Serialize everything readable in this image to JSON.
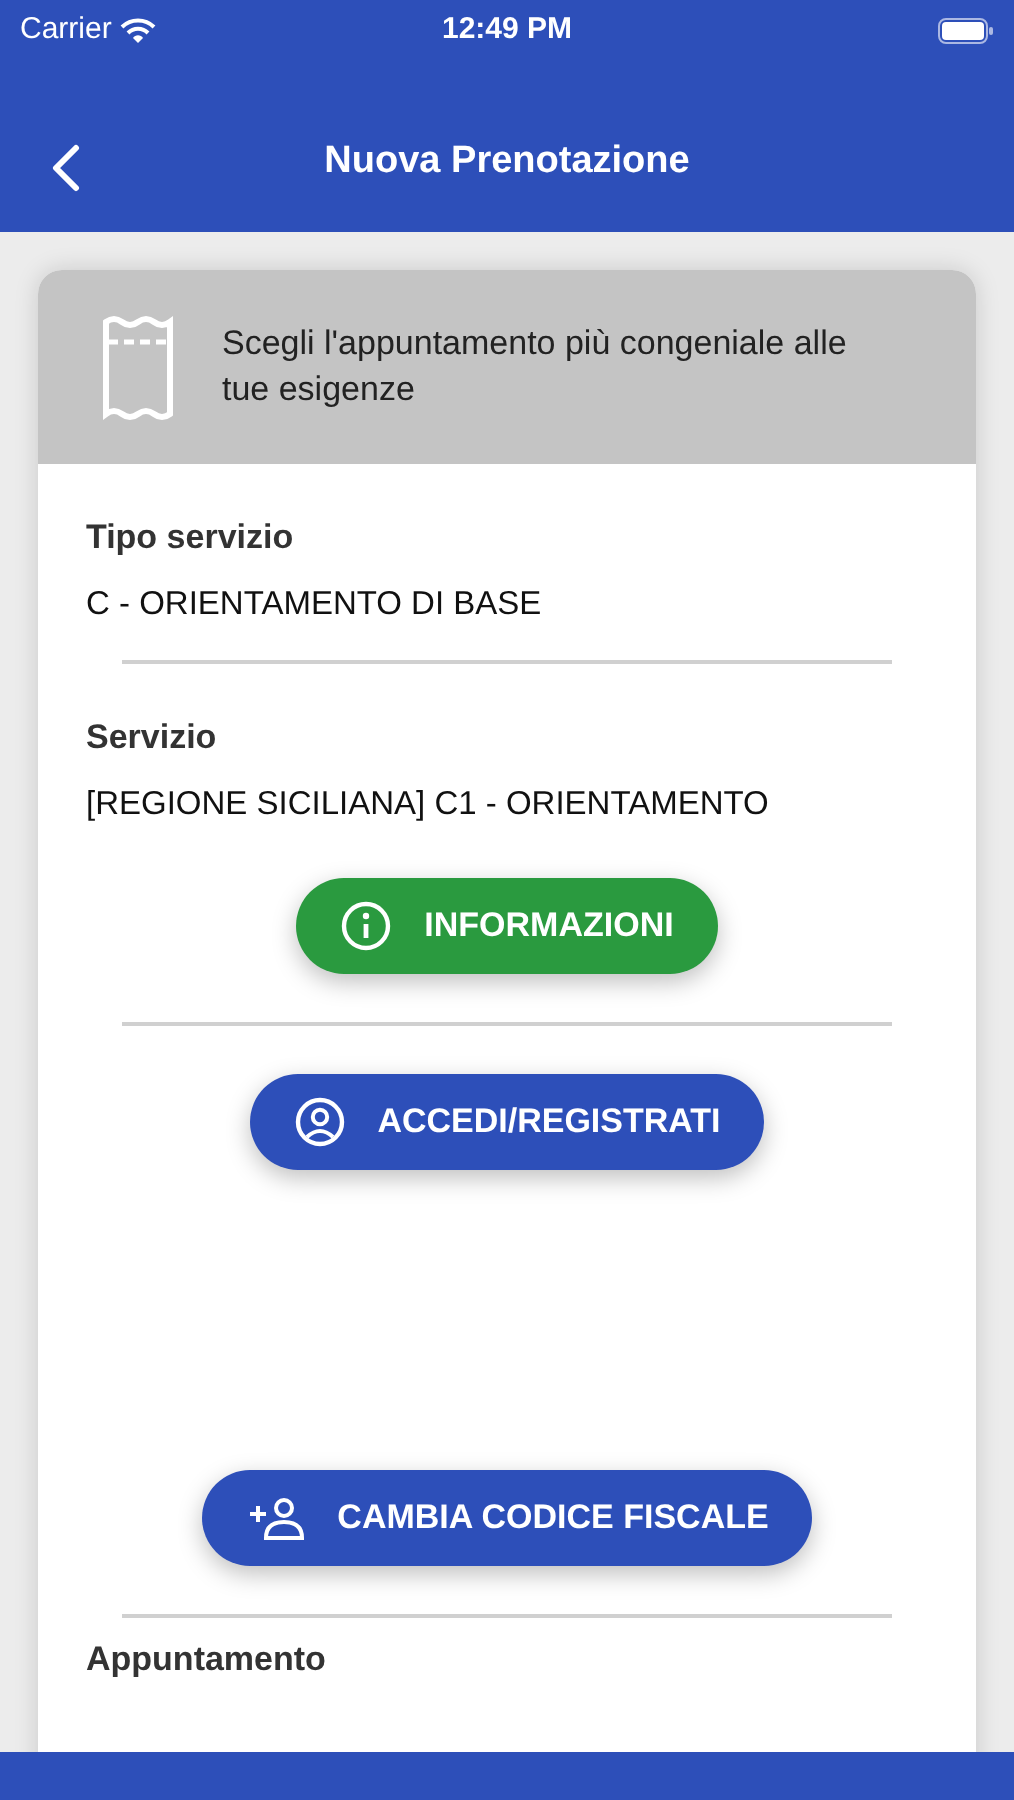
{
  "status_bar": {
    "carrier": "Carrier",
    "time": "12:49 PM"
  },
  "nav": {
    "title": "Nuova Prenotazione"
  },
  "banner": {
    "text": "Scegli l'appuntamento più congeniale alle tue esigenze"
  },
  "fields": [
    {
      "label": "Tipo servizio",
      "value": "C - ORIENTAMENTO DI BASE"
    },
    {
      "label": "Servizio",
      "value": "[REGIONE SICILIANA] C1 - ORIENTAMENTO"
    }
  ],
  "buttons": [
    {
      "label": "INFORMAZIONI",
      "kind": "info"
    },
    {
      "label": "ACCEDI/REGISTRATI",
      "kind": "login"
    },
    {
      "label": "CAMBIA CODICE FISCALE",
      "kind": "change"
    }
  ],
  "next_section": {
    "label": "Appuntamento"
  }
}
